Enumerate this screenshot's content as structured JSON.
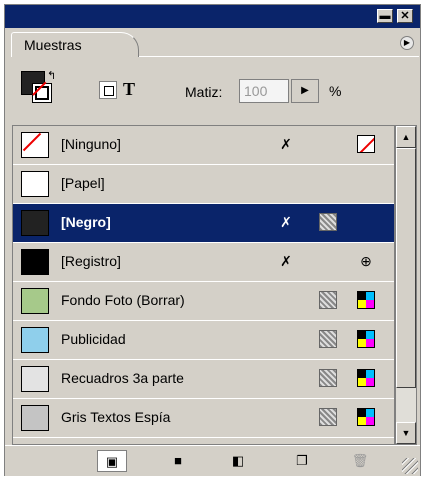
{
  "window": {
    "minimize_glyph": "▬",
    "close_glyph": "✕"
  },
  "tab": {
    "label": "Muestras",
    "menu_icon": "panel-menu-arrow-icon"
  },
  "controls": {
    "matiz_label": "Matiz:",
    "matiz_value": "100",
    "matiz_unit": "%",
    "text_toggle": "T",
    "stepper_glyph": "▶"
  },
  "swatches": [
    {
      "name": "[Ninguno]",
      "color": "#ffffff",
      "none": true,
      "selected": false,
      "icons": [
        "pencil-locked-icon",
        "none-swatch-icon"
      ]
    },
    {
      "name": "[Papel]",
      "color": "#ffffff",
      "selected": false,
      "icons": []
    },
    {
      "name": "[Negro]",
      "color": "#222222",
      "selected": true,
      "icons": [
        "pencil-locked-icon",
        "process-color-icon"
      ]
    },
    {
      "name": "[Registro]",
      "color": "#000000",
      "selected": false,
      "icons": [
        "pencil-locked-icon",
        "registration-icon"
      ]
    },
    {
      "name": "Fondo Foto (Borrar)",
      "color": "#a6c98a",
      "selected": false,
      "icons": [
        "process-color-icon",
        "cmyk-icon"
      ]
    },
    {
      "name": "Publicidad",
      "color": "#8fcfeb",
      "selected": false,
      "icons": [
        "process-color-icon",
        "cmyk-icon"
      ]
    },
    {
      "name": "Recuadros 3a parte",
      "color": "#e3e3e3",
      "selected": false,
      "icons": [
        "process-color-icon",
        "cmyk-icon"
      ]
    },
    {
      "name": "Gris Textos Espía",
      "color": "#c4c4c4",
      "selected": false,
      "icons": [
        "process-color-icon",
        "cmyk-icon"
      ]
    }
  ],
  "bottombar": {
    "buttons": [
      "show-all-swatches-icon",
      "show-color-swatches-icon",
      "show-gradient-swatches-icon",
      "new-swatch-icon",
      "delete-swatch-icon"
    ]
  }
}
